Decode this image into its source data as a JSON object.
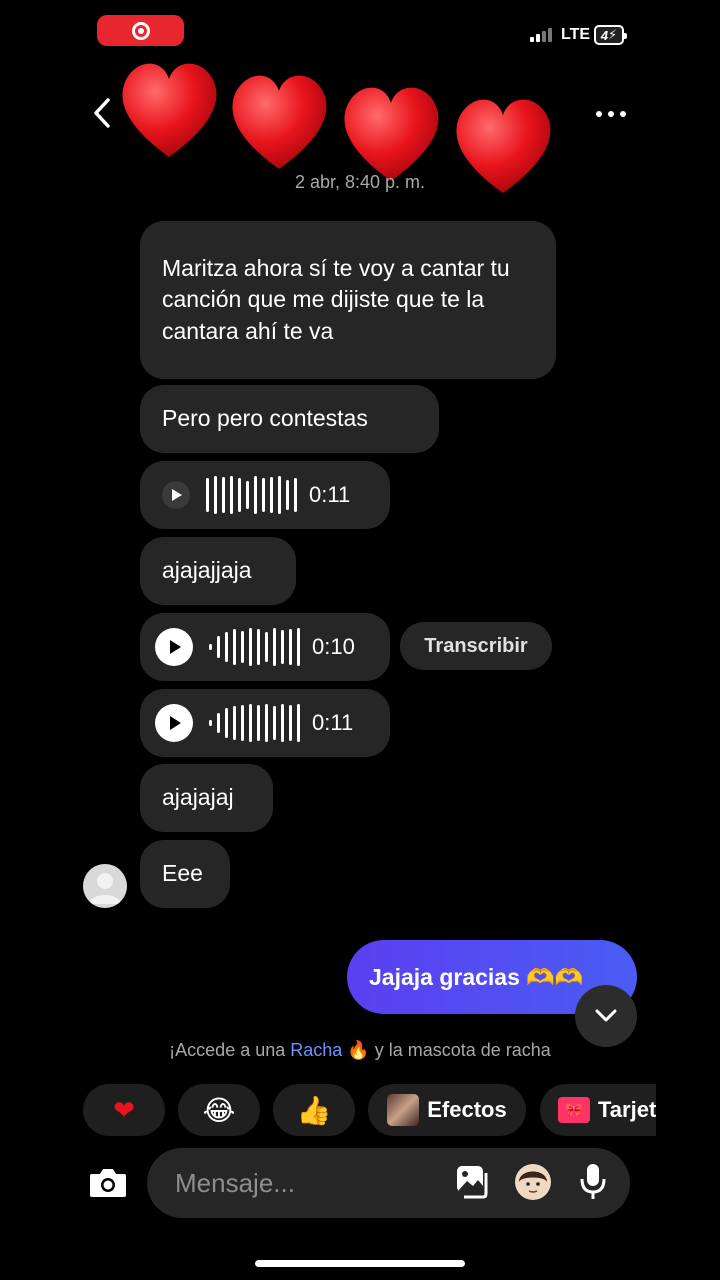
{
  "status_bar": {
    "network": "LTE",
    "battery": "4"
  },
  "header": {
    "title": "",
    "timestamp": "2 abr, 8:40 p. m."
  },
  "messages": [
    {
      "type": "text",
      "text": "Maritza ahora sí te voy a cantar tu canción que me dijiste que te la cantara ahí te va"
    },
    {
      "type": "text",
      "text": "Pero pero contestas"
    },
    {
      "type": "audio",
      "duration": "0:11"
    },
    {
      "type": "text",
      "text": "ajajajjaja"
    },
    {
      "type": "audio",
      "duration": "0:10",
      "action": "Transcribir"
    },
    {
      "type": "audio",
      "duration": "0:11"
    },
    {
      "type": "text",
      "text": "ajajajaj"
    },
    {
      "type": "text",
      "text": "Eee"
    }
  ],
  "sent_message": {
    "text": "Jajaja gracias 🫶🫶"
  },
  "streak_banner": {
    "prefix": "¡Accede a una ",
    "link": "Racha",
    "suffix": " y la mascota de racha"
  },
  "quick_actions": [
    {
      "icon": "heart-emoji",
      "label": ""
    },
    {
      "icon": "laughing-emoji",
      "label": ""
    },
    {
      "icon": "thumbs-up-emoji",
      "label": ""
    },
    {
      "icon": "effects-thumbnail",
      "label": "Efectos"
    },
    {
      "icon": "gift-card-icon",
      "label": "Tarjet"
    }
  ],
  "composer": {
    "placeholder": "Mensaje..."
  },
  "colors": {
    "background": "#000000",
    "bubble": "#262626",
    "sent_bubble": "#5b3ff0",
    "link": "#6e95ff",
    "record": "#e8262d"
  }
}
